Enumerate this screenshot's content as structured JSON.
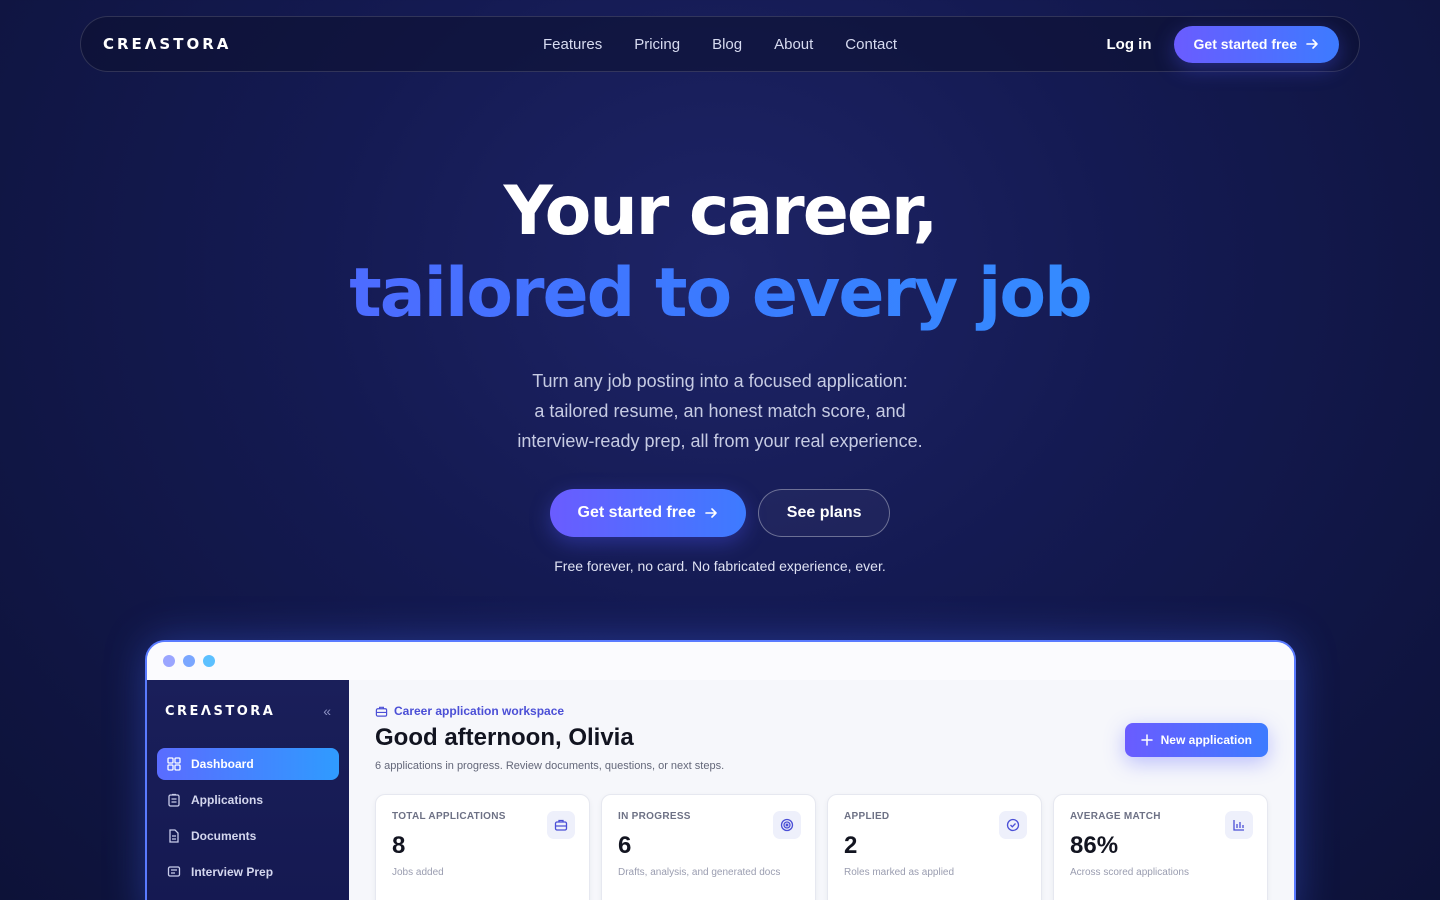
{
  "nav": {
    "logo": "CREΛSTORA",
    "links": [
      "Features",
      "Pricing",
      "Blog",
      "About",
      "Contact"
    ],
    "login": "Log in",
    "cta": "Get started free"
  },
  "hero": {
    "title_line1": "Your career,",
    "title_line2": "tailored to every job",
    "subtitle_lines": [
      "Turn any job posting into a focused application:",
      "a tailored resume, an honest match score, and",
      "interview-ready prep, all from your real experience."
    ],
    "primary_cta": "Get started free",
    "secondary_cta": "See plans",
    "fine_print": "Free forever, no card. No fabricated experience, ever."
  },
  "preview": {
    "window_dots": [
      "#9aa5ff",
      "#7aa6ff",
      "#5cc0ff"
    ],
    "sidebar": {
      "logo": "CREΛSTORA",
      "collapse_glyph": "«",
      "items": [
        {
          "label": "Dashboard",
          "icon": "grid-icon",
          "active": true
        },
        {
          "label": "Applications",
          "icon": "clipboard-icon",
          "active": false
        },
        {
          "label": "Documents",
          "icon": "document-icon",
          "active": false
        },
        {
          "label": "Interview Prep",
          "icon": "chat-icon",
          "active": false
        }
      ]
    },
    "main": {
      "crumb": "Career application workspace",
      "greeting": "Good afternoon, Olivia",
      "greeting_sub": "6 applications in progress. Review documents, questions, or next steps.",
      "new_button": "New application",
      "cards": [
        {
          "label": "TOTAL APPLICATIONS",
          "value": "8",
          "note": "Jobs added",
          "icon": "briefcase-icon"
        },
        {
          "label": "IN PROGRESS",
          "value": "6",
          "note": "Drafts, analysis, and generated docs",
          "icon": "target-icon"
        },
        {
          "label": "APPLIED",
          "value": "2",
          "note": "Roles marked as applied",
          "icon": "check-circle-icon"
        },
        {
          "label": "AVERAGE MATCH",
          "value": "86%",
          "note": "Across scored applications",
          "icon": "bar-chart-icon"
        }
      ]
    }
  },
  "colors": {
    "accent_start": "#6a5cff",
    "accent_end": "#3d7bff",
    "bg_dark": "#141a52"
  }
}
